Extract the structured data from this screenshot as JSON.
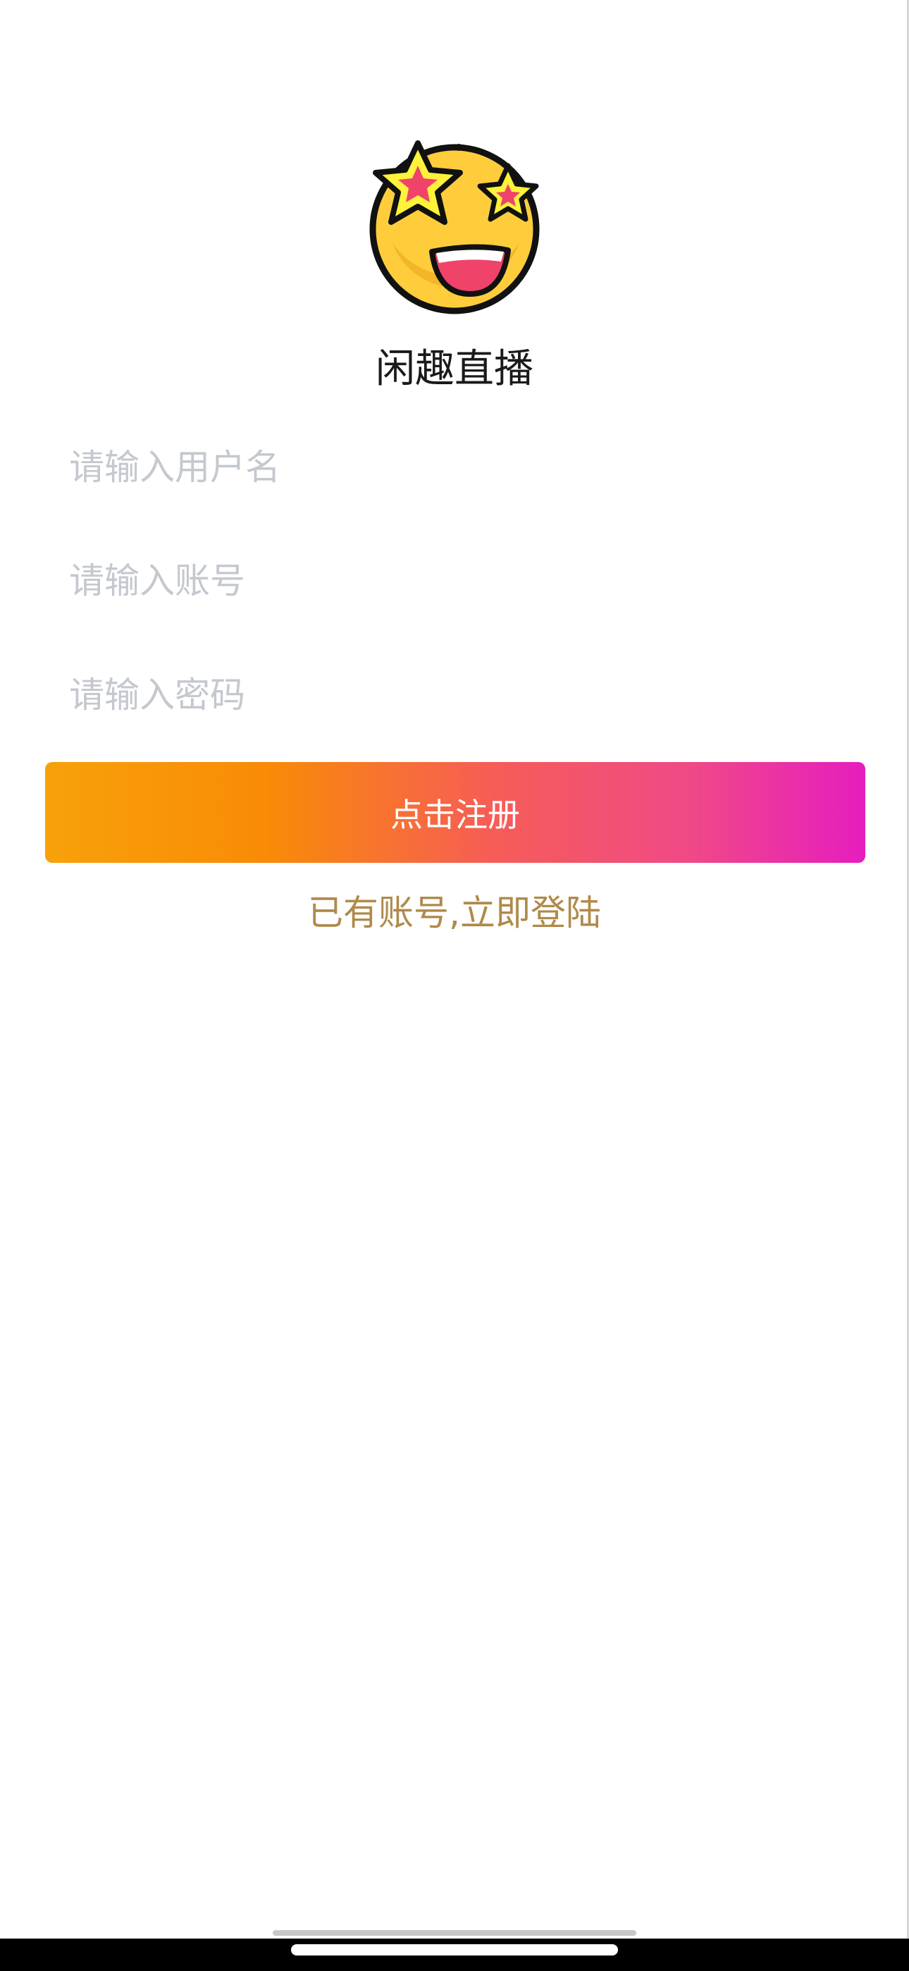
{
  "app": {
    "title": "闲趣直播",
    "logo_icon": "star-eyes-emoji-icon"
  },
  "form": {
    "username": {
      "value": "",
      "placeholder": "请输入用户名"
    },
    "account": {
      "value": "",
      "placeholder": "请输入账号"
    },
    "password": {
      "value": "",
      "placeholder": "请输入密码"
    },
    "register_label": "点击注册",
    "login_link": "已有账号,立即登陆"
  },
  "colors": {
    "gradient_start": "#f8a10a",
    "gradient_end": "#e61dbf",
    "link": "#b08a4a",
    "placeholder": "#c4c8cf"
  }
}
